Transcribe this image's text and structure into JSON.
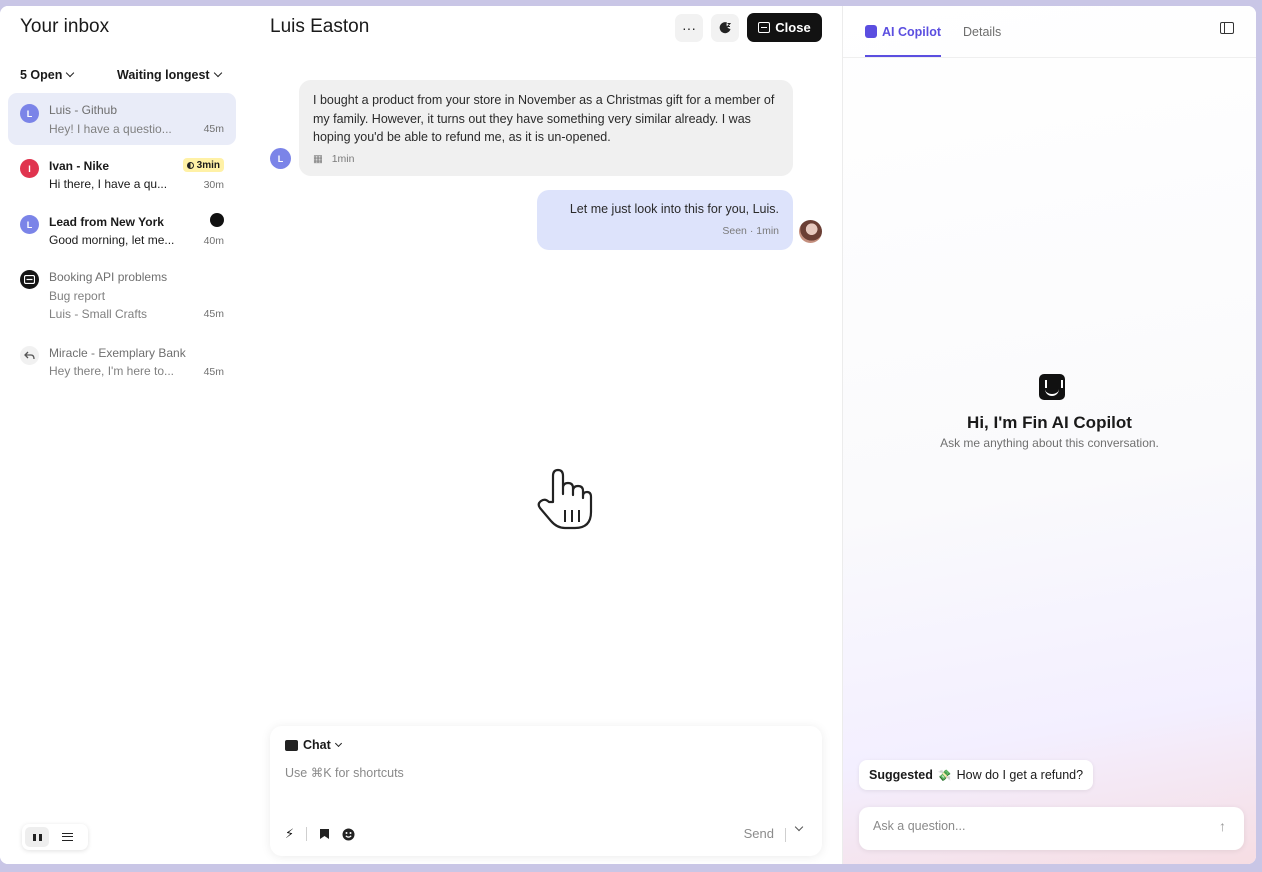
{
  "inbox": {
    "title": "Your inbox",
    "filter_status": "5 Open",
    "filter_sort": "Waiting longest",
    "conversations": [
      {
        "avatar": "L",
        "name": "Luis - Github",
        "preview": "Hey! I have a questio...",
        "time": "45m"
      },
      {
        "avatar": "I",
        "name": "Ivan - Nike",
        "preview": "Hi there, I have a qu...",
        "time": "30m",
        "sla": "3min"
      },
      {
        "avatar": "L",
        "name": "Lead from New York",
        "preview": "Good morning, let me...",
        "time": "40m"
      },
      {
        "name": "Booking API problems",
        "preview": "Bug report",
        "detail": "Luis - Small Crafts",
        "time": "45m"
      },
      {
        "name": "Miracle - Exemplary Bank",
        "preview": "Hey there, I'm here to...",
        "time": "45m"
      }
    ]
  },
  "conversation": {
    "title": "Luis Easton",
    "more_label": "···",
    "close_label": "Close",
    "messages": [
      {
        "avatar": "L",
        "text": "I bought a product from your store in November as a Christmas gift for a member of my family. However, it turns out they have something very similar already. I was hoping you'd be able to refund me, as it is un-opened.",
        "meta": "1min"
      },
      {
        "text": "Let me just look into this for you, Luis.",
        "meta": "Seen · 1min"
      }
    ],
    "composer": {
      "mode": "Chat",
      "placeholder": "Use ⌘K for shortcuts",
      "send_label": "Send"
    }
  },
  "copilot": {
    "tab_copilot": "AI Copilot",
    "tab_details": "Details",
    "title": "Hi, I'm Fin AI Copilot",
    "subtitle": "Ask me anything about this conversation.",
    "suggested_label": "Suggested",
    "suggested_question": "How do I get a refund?",
    "ask_placeholder": "Ask a question..."
  },
  "colors": {
    "accent": "#5b4ee0",
    "avatar_luis": "#7b84e8",
    "avatar_ivan": "#e0344f",
    "sla_badge": "#fff1a6"
  }
}
